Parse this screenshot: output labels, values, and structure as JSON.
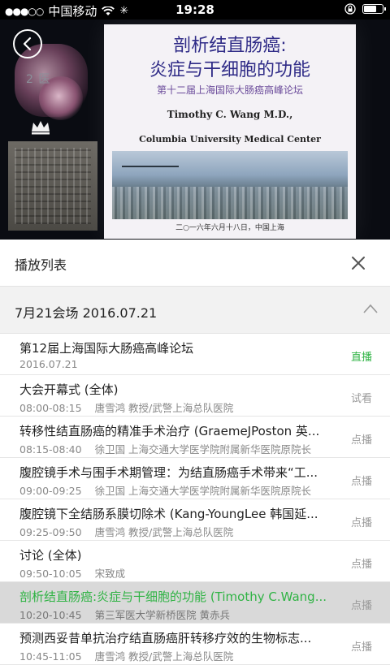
{
  "status_bar": {
    "carrier": "中国移动",
    "time": "19:28",
    "battery_percent": 70
  },
  "video": {
    "slide_title_line1": "剖析结直肠癌:",
    "slide_title_line2": "炎症与干细胞的功能",
    "slide_subtitle": "第十二届上海国际大肠癌高峰论坛",
    "slide_author": "Timothy  C. Wang M.D.,",
    "slide_org": "Columbia University Medical Center",
    "slide_date": "二○一六年六月十八日，中国上海",
    "overlay_text": "2 医"
  },
  "playlist": {
    "title": "播放列表",
    "section": {
      "title": "7月21会场   2016.07.21"
    },
    "items": [
      {
        "title": "第12届上海国际大肠癌高峰论坛",
        "time": "2016.07.21",
        "speaker": "",
        "status": "直播",
        "live": true,
        "active": false
      },
      {
        "title": "大会开幕式 (全体)",
        "time": "08:00-08:15",
        "speaker": "唐雪鸿 教授/武警上海总队医院",
        "status": "试看",
        "live": false,
        "active": false
      },
      {
        "title": "转移性结直肠癌的精准手术治疗 (GraemeJPoston 英...",
        "time": "08:15-08:40",
        "speaker": "徐卫国 上海交通大学医学院附属新华医院原院长",
        "status": "点播",
        "live": false,
        "active": false
      },
      {
        "title": "腹腔镜手术与围手术期管理：为结直肠癌手术带来“工...",
        "time": "09:00-09:25",
        "speaker": "徐卫国 上海交通大学医学院附属新华医院原院长",
        "status": "点播",
        "live": false,
        "active": false
      },
      {
        "title": "腹腔镜下全结肠系膜切除术 (Kang-YoungLee 韩国延...",
        "time": "09:25-09:50",
        "speaker": "唐雪鸿 教授/武警上海总队医院",
        "status": "点播",
        "live": false,
        "active": false
      },
      {
        "title": "讨论 (全体)",
        "time": "09:50-10:05",
        "speaker": "宋致成",
        "status": "点播",
        "live": false,
        "active": false
      },
      {
        "title": "剖析结直肠癌:炎症与干细胞的功能 (Timothy C.Wang...",
        "time": "10:20-10:45",
        "speaker": "第三军医大学新桥医院 黄赤兵",
        "status": "点播",
        "live": false,
        "active": true
      },
      {
        "title": "预测西妥昔单抗治疗结直肠癌肝转移疗效的生物标志...",
        "time": "10:45-11:05",
        "speaker": "唐雪鸿 教授/武警上海总队医院",
        "status": "点播",
        "live": false,
        "active": false
      }
    ]
  }
}
